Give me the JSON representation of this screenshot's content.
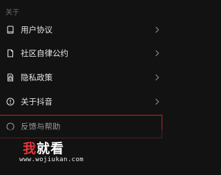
{
  "section": {
    "title": "关于"
  },
  "menu": {
    "items": [
      {
        "label": "用户协议",
        "icon": "book-icon"
      },
      {
        "label": "社区自律公约",
        "icon": "document-icon"
      },
      {
        "label": "隐私政策",
        "icon": "lock-document-icon"
      },
      {
        "label": "关于抖音",
        "icon": "info-icon"
      },
      {
        "label": "反馈与帮助",
        "icon": "help-icon"
      }
    ]
  },
  "watermark": {
    "title_part1": "我",
    "title_part2": "就看",
    "url": "www.wojiukan.com"
  },
  "colors": {
    "background": "#121212",
    "text": "#e6e6e6",
    "muted": "#6c6c6c",
    "highlight_border": "#c2262a",
    "brand_red": "#e8373c"
  }
}
